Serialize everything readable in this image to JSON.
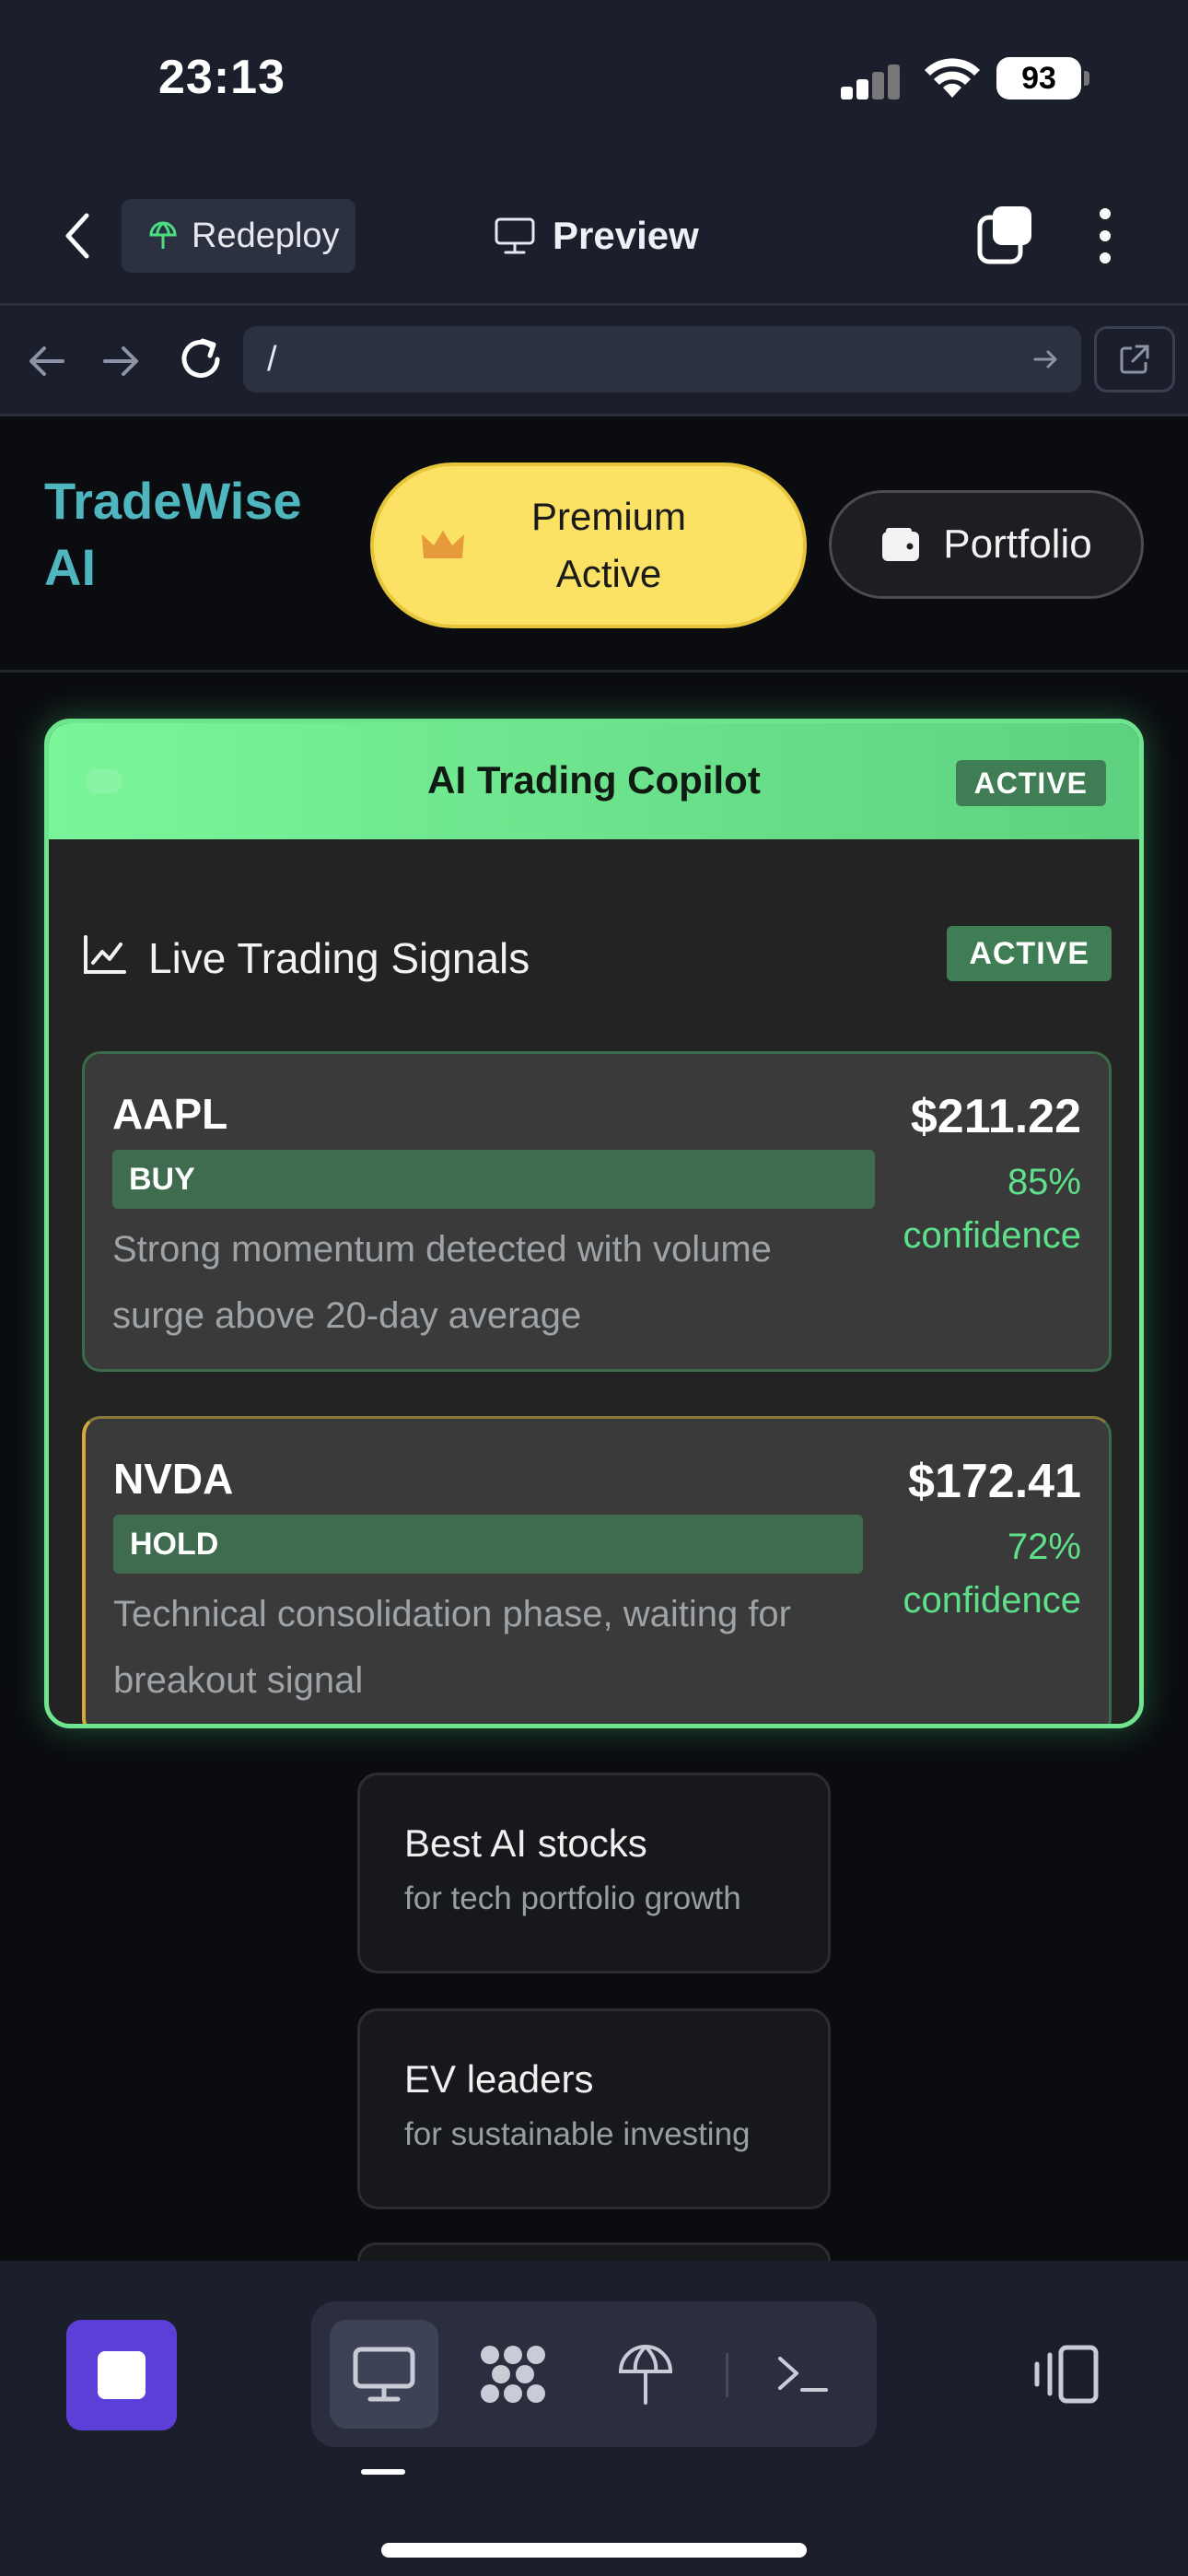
{
  "status_bar": {
    "time": "23:13",
    "battery": "93"
  },
  "ide_header": {
    "redeploy_label": "Redeploy",
    "preview_label": "Preview"
  },
  "browser": {
    "url": "/"
  },
  "app": {
    "brand": "TradeWise AI",
    "premium_label": "Premium Active",
    "portfolio_label": "Portfolio",
    "colors": {
      "brand": "#4fb6bf",
      "premium": "#fbe264",
      "accent_green": "#6ee58e",
      "confidence": "#5ee08a"
    }
  },
  "copilot": {
    "title": "AI Trading Copilot",
    "status": "ACTIVE",
    "signals_title": "Live Trading Signals",
    "signals_status": "ACTIVE",
    "signals": [
      {
        "ticker": "AAPL",
        "action": "BUY",
        "reason": "Strong momentum detected with volume surge above 20-day average",
        "price": "$211.22",
        "confidence": "85%",
        "confidence_label": "confidence"
      },
      {
        "ticker": "NVDA",
        "action": "HOLD",
        "reason": "Technical consolidation phase, waiting for breakout signal",
        "price": "$172.41",
        "confidence": "72%",
        "confidence_label": "confidence"
      }
    ]
  },
  "suggestions": [
    {
      "title": "Best AI stocks",
      "subtitle": "for tech portfolio growth"
    },
    {
      "title": "EV leaders",
      "subtitle": "for sustainable investing"
    }
  ],
  "dock": {
    "icons": [
      "stop-icon",
      "desktop-preview-icon",
      "apps-grid-icon",
      "deploy-icon",
      "terminal-icon",
      "layout-switch-icon"
    ]
  }
}
